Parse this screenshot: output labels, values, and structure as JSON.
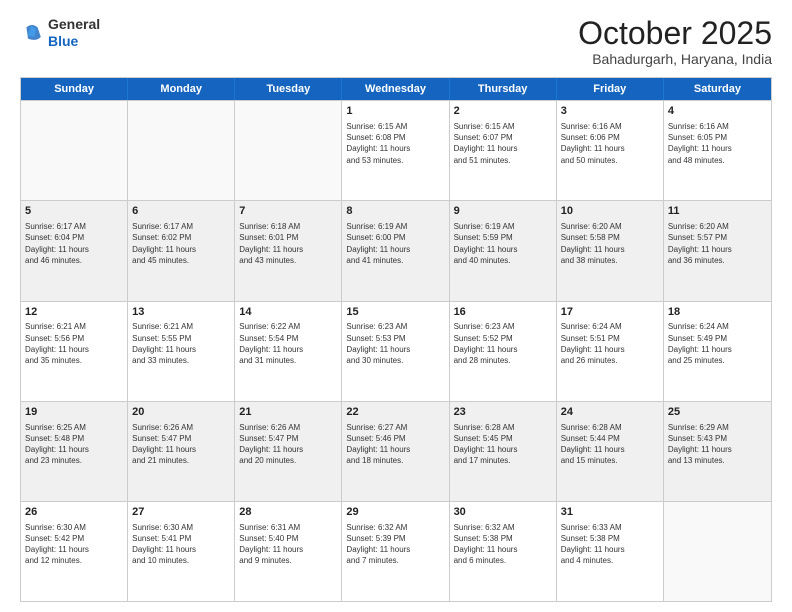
{
  "logo": {
    "general": "General",
    "blue": "Blue"
  },
  "header": {
    "month": "October 2025",
    "location": "Bahadurgarh, Haryana, India"
  },
  "days": [
    "Sunday",
    "Monday",
    "Tuesday",
    "Wednesday",
    "Thursday",
    "Friday",
    "Saturday"
  ],
  "weeks": [
    [
      {
        "day": "",
        "info": "",
        "empty": true
      },
      {
        "day": "",
        "info": "",
        "empty": true
      },
      {
        "day": "",
        "info": "",
        "empty": true
      },
      {
        "day": "1",
        "info": "Sunrise: 6:15 AM\nSunset: 6:08 PM\nDaylight: 11 hours\nand 53 minutes.",
        "empty": false
      },
      {
        "day": "2",
        "info": "Sunrise: 6:15 AM\nSunset: 6:07 PM\nDaylight: 11 hours\nand 51 minutes.",
        "empty": false
      },
      {
        "day": "3",
        "info": "Sunrise: 6:16 AM\nSunset: 6:06 PM\nDaylight: 11 hours\nand 50 minutes.",
        "empty": false
      },
      {
        "day": "4",
        "info": "Sunrise: 6:16 AM\nSunset: 6:05 PM\nDaylight: 11 hours\nand 48 minutes.",
        "empty": false
      }
    ],
    [
      {
        "day": "5",
        "info": "Sunrise: 6:17 AM\nSunset: 6:04 PM\nDaylight: 11 hours\nand 46 minutes.",
        "empty": false
      },
      {
        "day": "6",
        "info": "Sunrise: 6:17 AM\nSunset: 6:02 PM\nDaylight: 11 hours\nand 45 minutes.",
        "empty": false
      },
      {
        "day": "7",
        "info": "Sunrise: 6:18 AM\nSunset: 6:01 PM\nDaylight: 11 hours\nand 43 minutes.",
        "empty": false
      },
      {
        "day": "8",
        "info": "Sunrise: 6:19 AM\nSunset: 6:00 PM\nDaylight: 11 hours\nand 41 minutes.",
        "empty": false
      },
      {
        "day": "9",
        "info": "Sunrise: 6:19 AM\nSunset: 5:59 PM\nDaylight: 11 hours\nand 40 minutes.",
        "empty": false
      },
      {
        "day": "10",
        "info": "Sunrise: 6:20 AM\nSunset: 5:58 PM\nDaylight: 11 hours\nand 38 minutes.",
        "empty": false
      },
      {
        "day": "11",
        "info": "Sunrise: 6:20 AM\nSunset: 5:57 PM\nDaylight: 11 hours\nand 36 minutes.",
        "empty": false
      }
    ],
    [
      {
        "day": "12",
        "info": "Sunrise: 6:21 AM\nSunset: 5:56 PM\nDaylight: 11 hours\nand 35 minutes.",
        "empty": false
      },
      {
        "day": "13",
        "info": "Sunrise: 6:21 AM\nSunset: 5:55 PM\nDaylight: 11 hours\nand 33 minutes.",
        "empty": false
      },
      {
        "day": "14",
        "info": "Sunrise: 6:22 AM\nSunset: 5:54 PM\nDaylight: 11 hours\nand 31 minutes.",
        "empty": false
      },
      {
        "day": "15",
        "info": "Sunrise: 6:23 AM\nSunset: 5:53 PM\nDaylight: 11 hours\nand 30 minutes.",
        "empty": false
      },
      {
        "day": "16",
        "info": "Sunrise: 6:23 AM\nSunset: 5:52 PM\nDaylight: 11 hours\nand 28 minutes.",
        "empty": false
      },
      {
        "day": "17",
        "info": "Sunrise: 6:24 AM\nSunset: 5:51 PM\nDaylight: 11 hours\nand 26 minutes.",
        "empty": false
      },
      {
        "day": "18",
        "info": "Sunrise: 6:24 AM\nSunset: 5:49 PM\nDaylight: 11 hours\nand 25 minutes.",
        "empty": false
      }
    ],
    [
      {
        "day": "19",
        "info": "Sunrise: 6:25 AM\nSunset: 5:48 PM\nDaylight: 11 hours\nand 23 minutes.",
        "empty": false
      },
      {
        "day": "20",
        "info": "Sunrise: 6:26 AM\nSunset: 5:47 PM\nDaylight: 11 hours\nand 21 minutes.",
        "empty": false
      },
      {
        "day": "21",
        "info": "Sunrise: 6:26 AM\nSunset: 5:47 PM\nDaylight: 11 hours\nand 20 minutes.",
        "empty": false
      },
      {
        "day": "22",
        "info": "Sunrise: 6:27 AM\nSunset: 5:46 PM\nDaylight: 11 hours\nand 18 minutes.",
        "empty": false
      },
      {
        "day": "23",
        "info": "Sunrise: 6:28 AM\nSunset: 5:45 PM\nDaylight: 11 hours\nand 17 minutes.",
        "empty": false
      },
      {
        "day": "24",
        "info": "Sunrise: 6:28 AM\nSunset: 5:44 PM\nDaylight: 11 hours\nand 15 minutes.",
        "empty": false
      },
      {
        "day": "25",
        "info": "Sunrise: 6:29 AM\nSunset: 5:43 PM\nDaylight: 11 hours\nand 13 minutes.",
        "empty": false
      }
    ],
    [
      {
        "day": "26",
        "info": "Sunrise: 6:30 AM\nSunset: 5:42 PM\nDaylight: 11 hours\nand 12 minutes.",
        "empty": false
      },
      {
        "day": "27",
        "info": "Sunrise: 6:30 AM\nSunset: 5:41 PM\nDaylight: 11 hours\nand 10 minutes.",
        "empty": false
      },
      {
        "day": "28",
        "info": "Sunrise: 6:31 AM\nSunset: 5:40 PM\nDaylight: 11 hours\nand 9 minutes.",
        "empty": false
      },
      {
        "day": "29",
        "info": "Sunrise: 6:32 AM\nSunset: 5:39 PM\nDaylight: 11 hours\nand 7 minutes.",
        "empty": false
      },
      {
        "day": "30",
        "info": "Sunrise: 6:32 AM\nSunset: 5:38 PM\nDaylight: 11 hours\nand 6 minutes.",
        "empty": false
      },
      {
        "day": "31",
        "info": "Sunrise: 6:33 AM\nSunset: 5:38 PM\nDaylight: 11 hours\nand 4 minutes.",
        "empty": false
      },
      {
        "day": "",
        "info": "",
        "empty": true
      }
    ]
  ]
}
